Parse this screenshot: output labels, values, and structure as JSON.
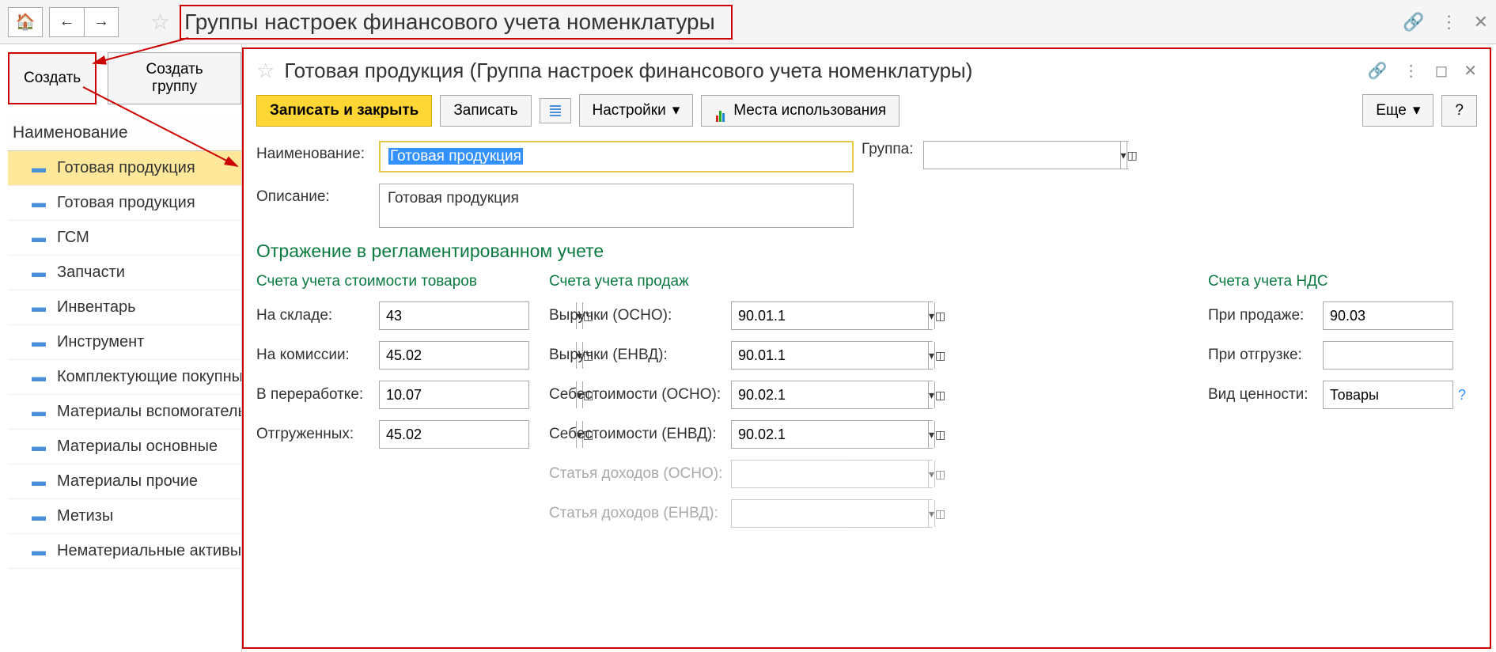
{
  "page": {
    "title": "Группы настроек финансового учета номенклатуры"
  },
  "left": {
    "create": "Создать",
    "create_group": "Создать группу",
    "header": "Наименование",
    "items": [
      "Готовая продукция",
      "Готовая продукция",
      "ГСМ",
      "Запчасти",
      "Инвентарь",
      "Инструмент",
      "Комплектующие покупные",
      "Материалы вспомогательные",
      "Материалы основные",
      "Материалы прочие",
      "Метизы",
      "Нематериальные активы"
    ]
  },
  "form": {
    "title": "Готовая продукция (Группа настроек финансового учета номенклатуры)",
    "toolbar": {
      "save_close": "Записать и закрыть",
      "save": "Записать",
      "settings": "Настройки",
      "usage": "Места использования",
      "more": "Еще",
      "help": "?"
    },
    "fields": {
      "name_label": "Наименование:",
      "name_value": "Готовая продукция",
      "desc_label": "Описание:",
      "desc_value": "Готовая продукция",
      "group_label": "Группа:",
      "group_value": ""
    },
    "section": "Отражение в регламентированном учете",
    "col1": {
      "title": "Счета учета стоимости товаров",
      "rows": [
        {
          "label": "На складе:",
          "value": "43"
        },
        {
          "label": "На комиссии:",
          "value": "45.02"
        },
        {
          "label": "В переработке:",
          "value": "10.07"
        },
        {
          "label": "Отгруженных:",
          "value": "45.02"
        }
      ]
    },
    "col2": {
      "title": "Счета учета продаж",
      "rows": [
        {
          "label": "Выручки (ОСНО):",
          "value": "90.01.1"
        },
        {
          "label": "Выручки (ЕНВД):",
          "value": "90.01.1"
        },
        {
          "label": "Себестоимости (ОСНО):",
          "value": "90.02.1"
        },
        {
          "label": "Себестоимости (ЕНВД):",
          "value": "90.02.1"
        },
        {
          "label": "Статья доходов (ОСНО):",
          "value": ""
        },
        {
          "label": "Статья доходов (ЕНВД):",
          "value": ""
        }
      ]
    },
    "col3": {
      "title": "Счета учета НДС",
      "rows": [
        {
          "label": "При продаже:",
          "value": "90.03"
        },
        {
          "label": "При отгрузке:",
          "value": ""
        },
        {
          "label": "Вид ценности:",
          "value": "Товары"
        }
      ]
    }
  }
}
